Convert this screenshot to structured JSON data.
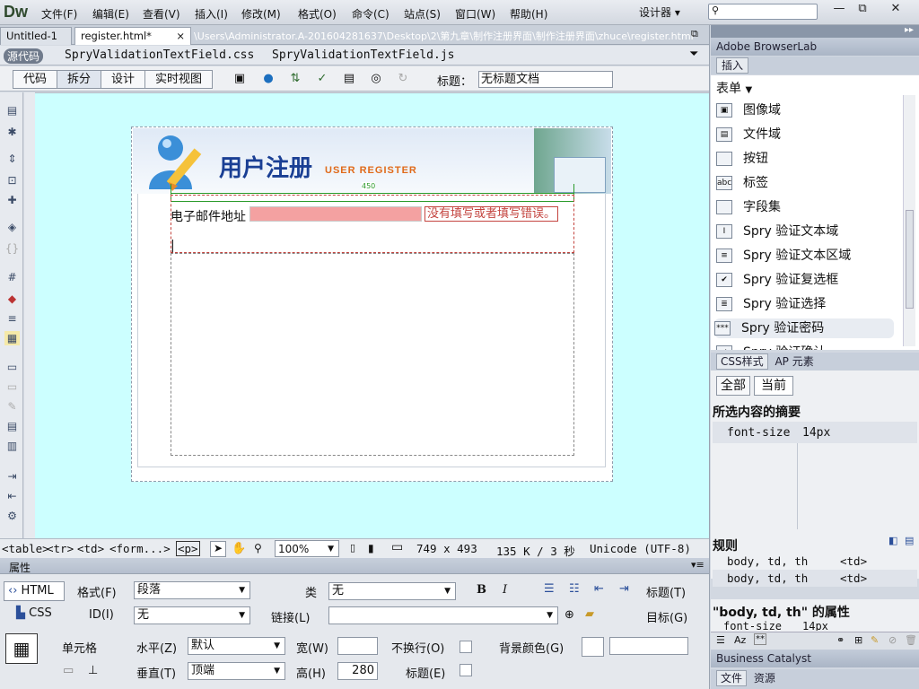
{
  "app": {
    "logo": "Dw",
    "designer": "设计器",
    "designer_arrow": "▾"
  },
  "menu": [
    "文件(F)",
    "编辑(E)",
    "查看(V)",
    "插入(I)",
    "修改(M)",
    "格式(O)",
    "命令(C)",
    "站点(S)",
    "窗口(W)",
    "帮助(H)"
  ],
  "window_buttons": [
    "—",
    "⧉",
    "✕"
  ],
  "tabs": {
    "untitled": "Untitled-1",
    "register": "register.html*",
    "path": "\\Users\\Administrator.A-201604281637\\Desktop\\2\\第九章\\制作注册界面\\制作注册界面\\zhuce\\register.html",
    "close_glyph": "×"
  },
  "related_files": {
    "source": "源代码",
    "files": [
      "SpryValidationTextField.css",
      "SpryValidationTextField.js"
    ]
  },
  "views": [
    "代码",
    "拆分",
    "设计",
    "实时视图"
  ],
  "doc_title": {
    "label": "标题：",
    "value": "无标题文档"
  },
  "page": {
    "title": "用户注册",
    "subtitle": "USER REGISTER",
    "width_label": "450",
    "email_label": "电子邮件地址",
    "error": "没有填写或者填写错误。",
    "cursor": "|"
  },
  "status": {
    "tags": [
      "<table>",
      "<tr>",
      "<td>",
      "<form...>",
      "<p>"
    ],
    "zoom": "100%",
    "size": "749 x 493",
    "weight": "135 K / 3 秒",
    "encoding": "Unicode (UTF-8)"
  },
  "properties": {
    "header": "属性",
    "html": "HTML",
    "css": "CSS",
    "format_label": "格式(F)",
    "format_value": "段落",
    "class_label": "类",
    "class_value": "无",
    "bold": "B",
    "italic": "I",
    "title_label": "标题(T)",
    "id_label": "ID(I)",
    "id_value": "无",
    "link_label": "链接(L)",
    "target_label": "目标(G)",
    "cell_label": "单元格",
    "halign_label": "水平(Z)",
    "halign_value": "默认",
    "width_label": "宽(W)",
    "nowrap_label": "不换行(O)",
    "bgcolor_label": "背景颜色(G)",
    "valign_label": "垂直(T)",
    "valign_value": "顶端",
    "height_label": "高(H)",
    "height_value": "280",
    "header_label": "标题(E)"
  },
  "panels": {
    "browserlab": "Adobe BrowserLab",
    "insert": "插入",
    "category": "表单",
    "css_tab": "CSS样式",
    "ap_tab": "AP 元素",
    "all": "全部",
    "current": "当前",
    "summary_title": "所选内容的摘要",
    "summary_prop": "font-size",
    "summary_val": "14px",
    "rules_title": "规则",
    "rules": [
      {
        "sel": "body, td, th",
        "tag": "<td>"
      },
      {
        "sel": "body, td, th",
        "tag": "<td>"
      }
    ],
    "props_title": "\"body, td, th\" 的属性",
    "props_prop": "font-size",
    "props_val": "14px",
    "bc": "Business Catalyst",
    "file_tab": "文件",
    "assets_tab": "资源"
  },
  "insert_items": [
    {
      "label": "图像域",
      "icon": "image-field-icon",
      "glyph": "▣"
    },
    {
      "label": "文件域",
      "icon": "file-field-icon",
      "glyph": "▤"
    },
    {
      "label": "按钮",
      "icon": "button-icon",
      "glyph": " "
    },
    {
      "label": "标签",
      "icon": "label-icon",
      "glyph": "abc"
    },
    {
      "label": "字段集",
      "icon": "fieldset-icon",
      "glyph": " "
    },
    {
      "label": "Spry 验证文本域",
      "icon": "spry-textfield-icon",
      "glyph": "I"
    },
    {
      "label": "Spry 验证文本区域",
      "icon": "spry-textarea-icon",
      "glyph": "≡"
    },
    {
      "label": "Spry 验证复选框",
      "icon": "spry-checkbox-icon",
      "glyph": "✔"
    },
    {
      "label": "Spry 验证选择",
      "icon": "spry-select-icon",
      "glyph": "≣"
    },
    {
      "label": "Spry 验证密码",
      "icon": "spry-password-icon",
      "glyph": "***"
    },
    {
      "label": "Spry 验证确认",
      "icon": "spry-confirm-icon",
      "glyph": "✓"
    }
  ],
  "colors": {
    "canvas": "#ccffff",
    "error": "#c4443f",
    "input_bg": "#f4a1a1",
    "title": "#1a3f94",
    "subtitle": "#e06a1a"
  }
}
